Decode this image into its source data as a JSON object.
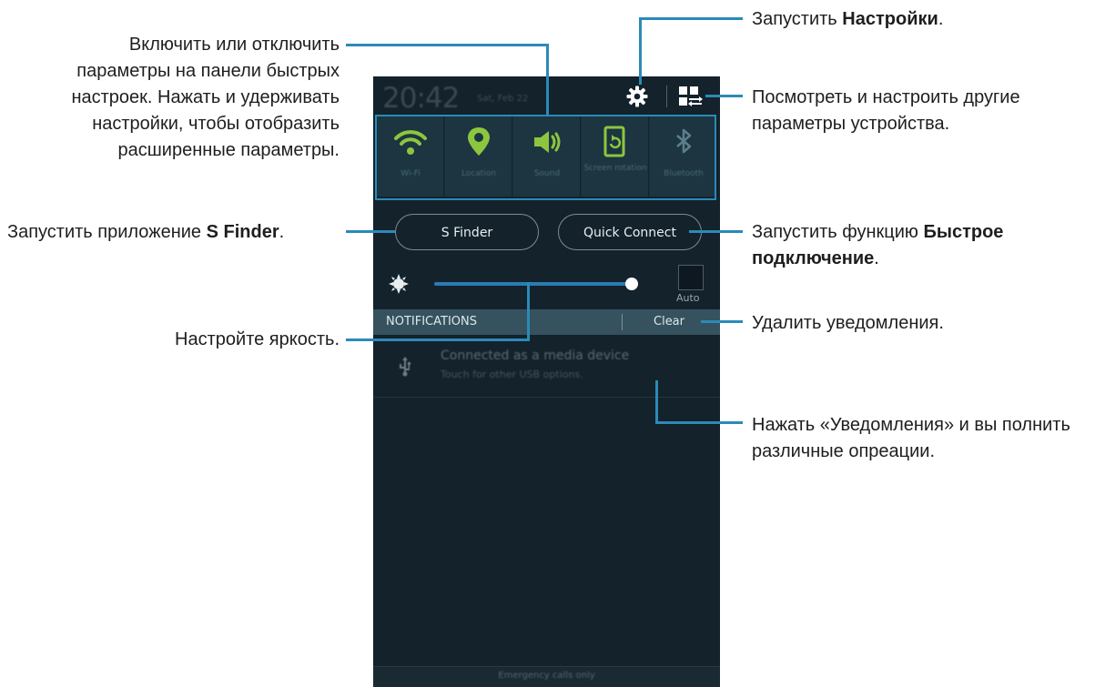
{
  "phone": {
    "status": {
      "time": "20:42",
      "date": "Sat, Feb 22"
    },
    "icons": {
      "settings": "gear-icon",
      "grid": "grid-settings-icon"
    },
    "quick_settings": [
      {
        "label": "Wi-Fi",
        "icon": "wifi-icon"
      },
      {
        "label": "Location",
        "icon": "location-icon"
      },
      {
        "label": "Sound",
        "icon": "sound-icon"
      },
      {
        "label": "Screen rotation",
        "icon": "screen-rotation-icon"
      },
      {
        "label": "Bluetooth",
        "icon": "bluetooth-icon"
      }
    ],
    "buttons": {
      "s_finder": "S Finder",
      "quick_connect": "Quick Connect"
    },
    "brightness": {
      "level": 0.95,
      "auto_label": "Auto"
    },
    "notifications": {
      "header": "NOTIFICATIONS",
      "clear": "Clear"
    },
    "notification_item": {
      "title": "Connected as a media device",
      "subtitle": "Touch for other USB options."
    },
    "footer": "Emergency calls only",
    "accent": "#2a7bb4",
    "icon_green": "#8cc63f"
  },
  "annotations": {
    "quick_settings": "Включить или отключить параметры на панели быстрых настроек. Нажать и удерживать настройки, чтобы отобразить расширенные параметры.",
    "settings_prefix": "Запустить ",
    "settings_bold": "Настройки",
    "settings_suffix": ".",
    "more_settings": "Посмотреть и настроить другие параметры устройства.",
    "s_finder_prefix": "Запустить приложение ",
    "s_finder_bold": "S Finder",
    "s_finder_suffix": ".",
    "quick_connect_prefix": "Запустить функцию ",
    "quick_connect_bold": "Быстрое подключение",
    "quick_connect_suffix": ".",
    "brightness": "Настройте яркость.",
    "clear": "Удалить уведомления.",
    "notifications": "Нажать «Уведомления» и вы полнить различные опреации."
  }
}
